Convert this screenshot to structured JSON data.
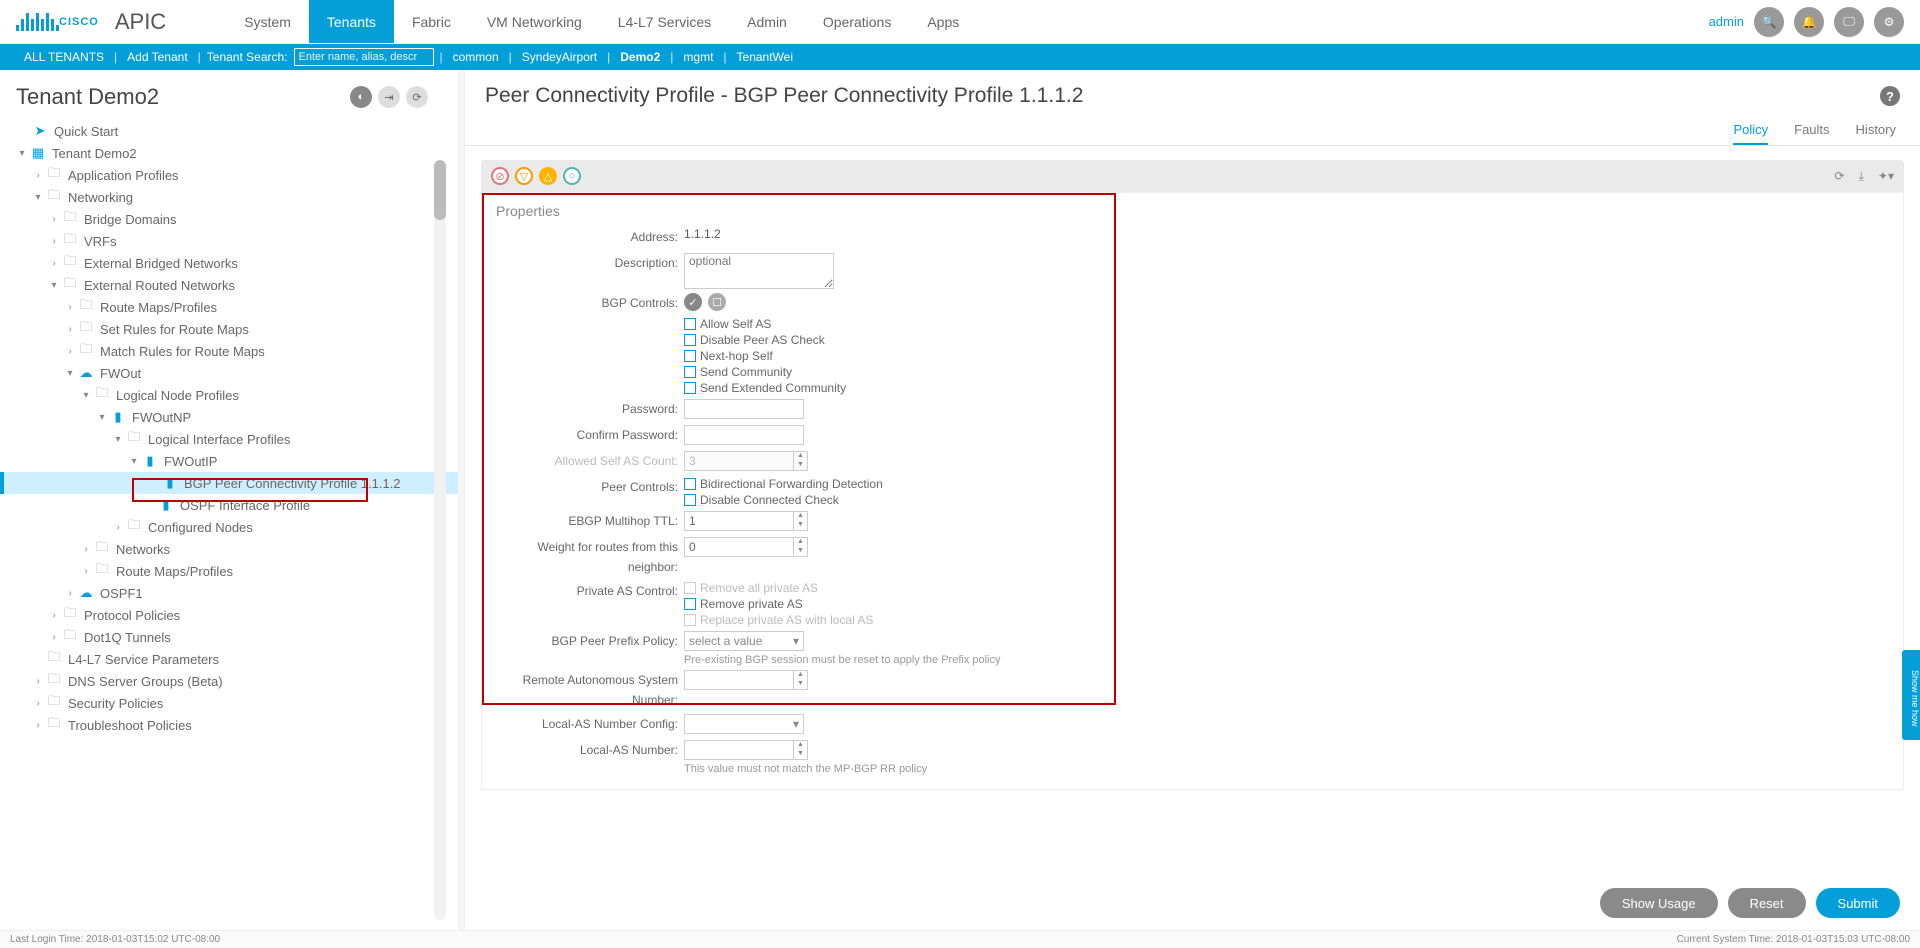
{
  "brand": {
    "name": "CISCO",
    "app": "APIC"
  },
  "topnav": [
    "System",
    "Tenants",
    "Fabric",
    "VM Networking",
    "L4-L7 Services",
    "Admin",
    "Operations",
    "Apps"
  ],
  "activeTopnav": 1,
  "user": "admin",
  "subnav": {
    "allTenants": "ALL TENANTS",
    "addTenant": "Add Tenant",
    "searchLabel": "Tenant Search:",
    "searchPlaceholder": "Enter name, alias, descr",
    "links": [
      "common",
      "SyndeyAirport",
      "Demo2",
      "mgmt",
      "TenantWei"
    ],
    "activeLink": 2
  },
  "leftPanel": {
    "title": "Tenant Demo2",
    "quickStart": "Quick Start",
    "tree": {
      "root": "Tenant Demo2",
      "appProfiles": "Application Profiles",
      "networking": "Networking",
      "bridgeDomains": "Bridge Domains",
      "vrfs": "VRFs",
      "extBridged": "External Bridged Networks",
      "extRouted": "External Routed Networks",
      "routeMaps": "Route Maps/Profiles",
      "setRules": "Set Rules for Route Maps",
      "matchRules": "Match Rules for Route Maps",
      "fwout": "FWOut",
      "logicalNode": "Logical Node Profiles",
      "fwoutnp": "FWOutNP",
      "logicalIf": "Logical Interface Profiles",
      "fwoutip": "FWOutIP",
      "bgpPeer": "BGP Peer Connectivity Profile 1.1.1.2",
      "ospfIfProfile": "OSPF Interface Profile",
      "configured": "Configured Nodes",
      "networks": "Networks",
      "routeMaps2": "Route Maps/Profiles",
      "ospf1": "OSPF1",
      "protocolPolicies": "Protocol Policies",
      "dot1q": "Dot1Q Tunnels",
      "l4l7": "L4-L7 Service Parameters",
      "dnsServer": "DNS Server Groups (Beta)",
      "security": "Security Policies",
      "troubleshoot": "Troubleshoot Policies"
    }
  },
  "rightPanel": {
    "title": "Peer Connectivity Profile - BGP Peer Connectivity Profile 1.1.1.2",
    "tabs": [
      "Policy",
      "Faults",
      "History"
    ],
    "activeTab": 0,
    "properties": {
      "header": "Properties",
      "address": {
        "label": "Address:",
        "value": "1.1.1.2"
      },
      "description": {
        "label": "Description:",
        "placeholder": "optional"
      },
      "bgpControls": {
        "label": "BGP Controls:",
        "items": [
          "Allow Self AS",
          "Disable Peer AS Check",
          "Next-hop Self",
          "Send Community",
          "Send Extended Community"
        ]
      },
      "password": {
        "label": "Password:"
      },
      "confirmPassword": {
        "label": "Confirm Password:"
      },
      "allowedSelfAS": {
        "label": "Allowed Self AS Count:",
        "value": "3"
      },
      "peerControls": {
        "label": "Peer Controls:",
        "items": [
          "Bidirectional Forwarding Detection",
          "Disable Connected Check"
        ]
      },
      "ebgpTTL": {
        "label": "EBGP Multihop TTL:",
        "value": "1"
      },
      "weight": {
        "label": "Weight for routes from this neighbor:",
        "value": "0"
      },
      "privateAS": {
        "label": "Private AS Control:",
        "items": [
          "Remove all private AS",
          "Remove private AS",
          "Replace private AS with local AS"
        ],
        "disabled": [
          true,
          false,
          true
        ]
      },
      "prefixPolicy": {
        "label": "BGP Peer Prefix Policy:",
        "placeholder": "select a value",
        "helper": "Pre-existing BGP session must be reset to apply the Prefix policy"
      },
      "remoteAS": {
        "label": "Remote Autonomous System Number:"
      },
      "localASConfig": {
        "label": "Local-AS Number Config:"
      },
      "localASNumber": {
        "label": "Local-AS Number:",
        "helper": "This value must not match the MP-BGP RR policy"
      }
    },
    "buttons": {
      "showUsage": "Show Usage",
      "reset": "Reset",
      "submit": "Submit"
    }
  },
  "showMe": "Show me how",
  "status": {
    "left": "Last Login Time: 2018-01-03T15:02 UTC-08:00",
    "right": "Current System Time: 2018-01-03T15:03 UTC-08:00"
  }
}
